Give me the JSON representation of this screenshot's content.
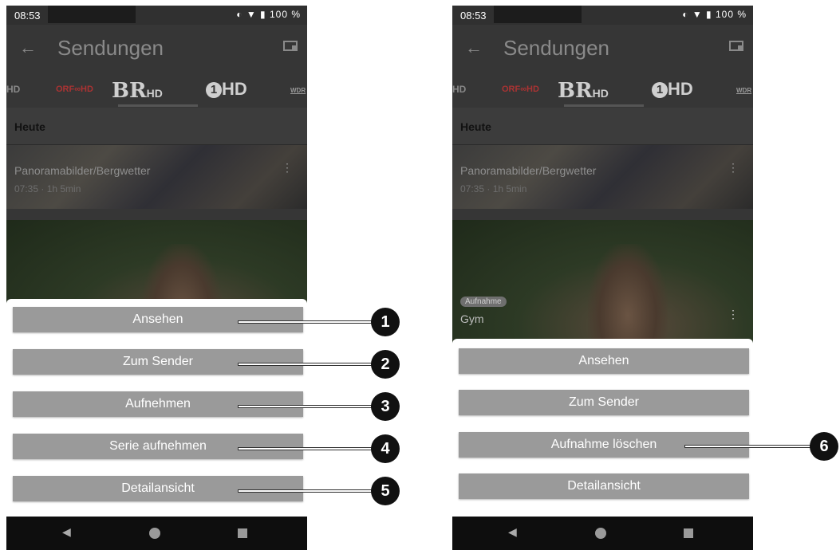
{
  "status": {
    "time": "08:53",
    "battery": "100 %"
  },
  "appbar": {
    "back": "←",
    "title": "Sendungen"
  },
  "tabs": {
    "hd1": "HD",
    "orf": "ORF∞HD",
    "br": "BR",
    "br_hd": "HD",
    "eins": "1",
    "eins_hd": "HD",
    "wdr": "WDR"
  },
  "section": {
    "title": "Heute"
  },
  "card1": {
    "title": "Panoramabilder/Bergwetter",
    "subtitle": "07:35 · 1h 5min",
    "menu": "⋮"
  },
  "card2": {
    "badge": "Aufnahme",
    "title": "Gym",
    "menu": "⋮"
  },
  "left_menu": {
    "buttons": [
      "Ansehen",
      "Zum Sender",
      "Aufnehmen",
      "Serie aufnehmen",
      "Detailansicht"
    ],
    "callouts": [
      "1",
      "2",
      "3",
      "4",
      "5"
    ]
  },
  "right_menu": {
    "buttons": [
      "Ansehen",
      "Zum Sender",
      "Aufnahme löschen",
      "Detailansicht"
    ],
    "callouts": [
      "6"
    ]
  },
  "navbar": {
    "back": "◀"
  }
}
